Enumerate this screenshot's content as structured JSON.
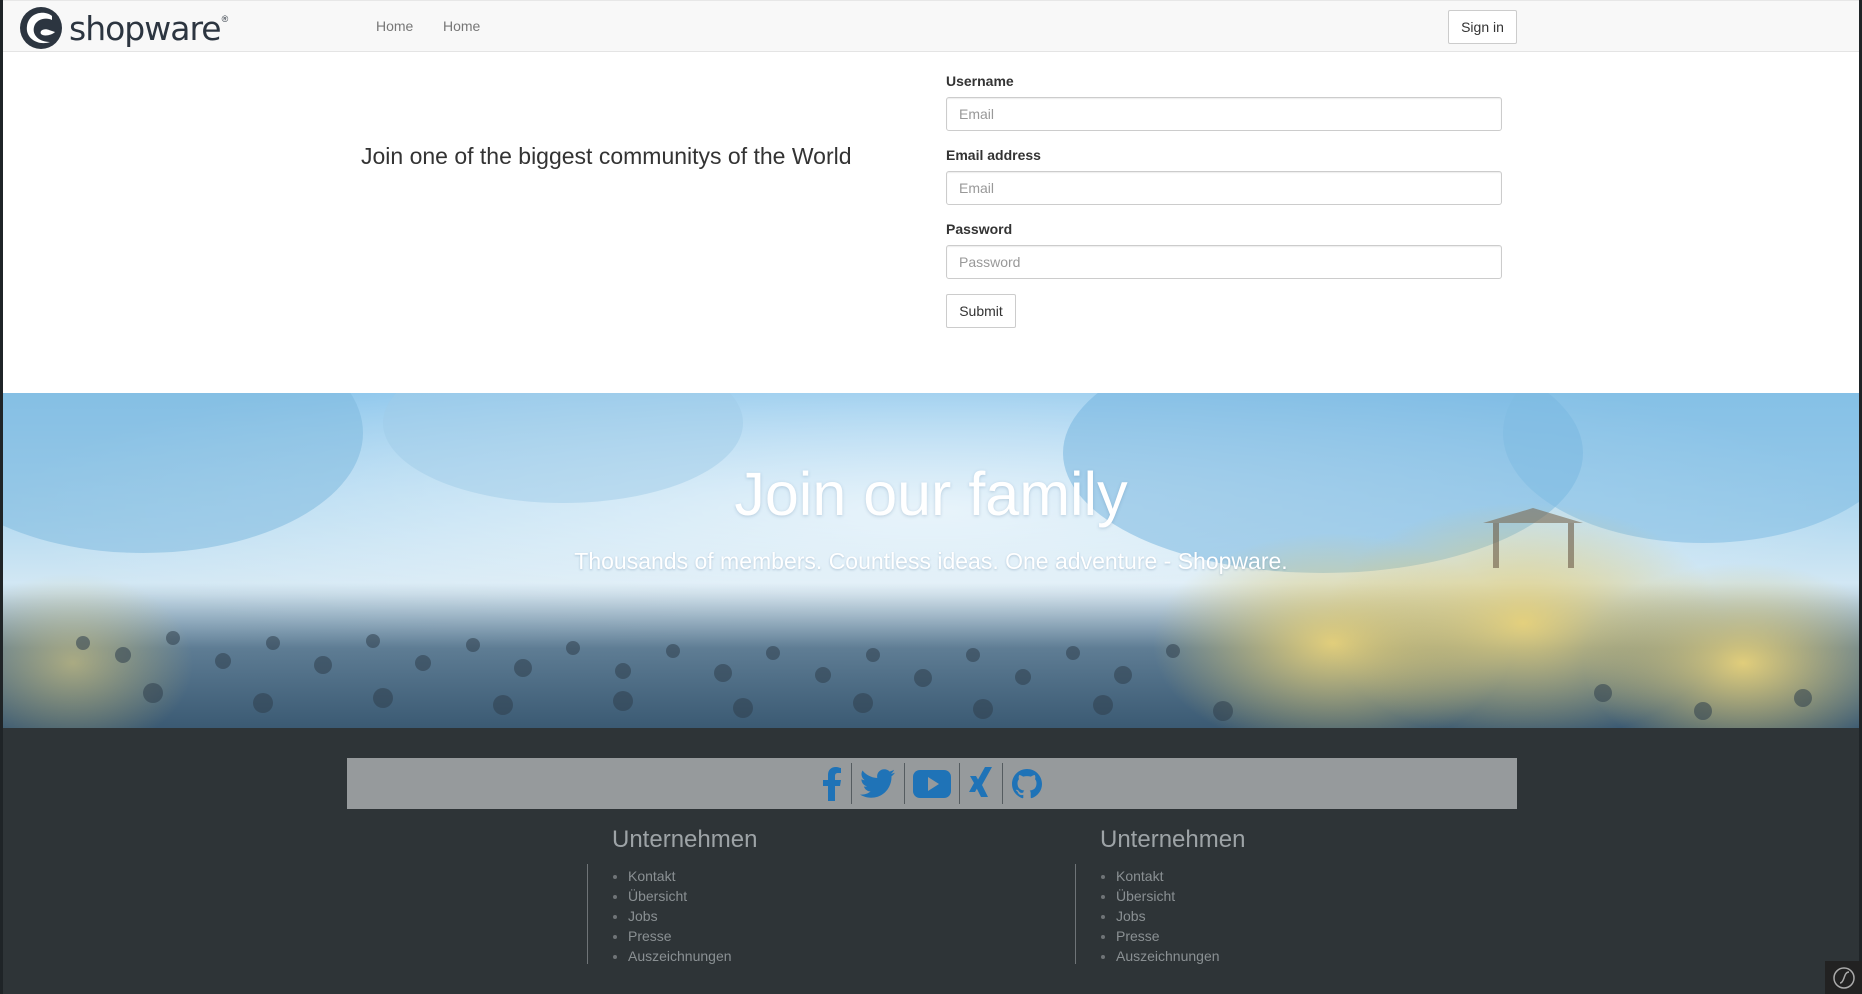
{
  "navbar": {
    "brand": "shopware",
    "brand_mark": "®",
    "links": [
      "Home",
      "Home"
    ],
    "signin_label": "Sign in"
  },
  "hero": {
    "tagline": "Join one of the biggest communitys of the World"
  },
  "form": {
    "username_label": "Username",
    "username_placeholder": "Email",
    "email_label": "Email address",
    "email_placeholder": "Email",
    "password_label": "Password",
    "password_placeholder": "Password",
    "submit_label": "Submit"
  },
  "banner": {
    "title": "Join our family",
    "subtitle": "Thousands of members. Countless ideas. One adventure - Shopware."
  },
  "footer": {
    "social": [
      "facebook-icon",
      "twitter-icon",
      "youtube-icon",
      "xing-icon",
      "github-icon"
    ],
    "social_color": "#1f73b7",
    "columns": [
      {
        "heading": "Unternehmen",
        "items": [
          "Kontakt",
          "Übersicht",
          "Jobs",
          "Presse",
          "Auszeichnungen"
        ]
      },
      {
        "heading": "Unternehmen",
        "items": [
          "Kontakt",
          "Übersicht",
          "Jobs",
          "Presse",
          "Auszeichnungen"
        ]
      }
    ]
  }
}
